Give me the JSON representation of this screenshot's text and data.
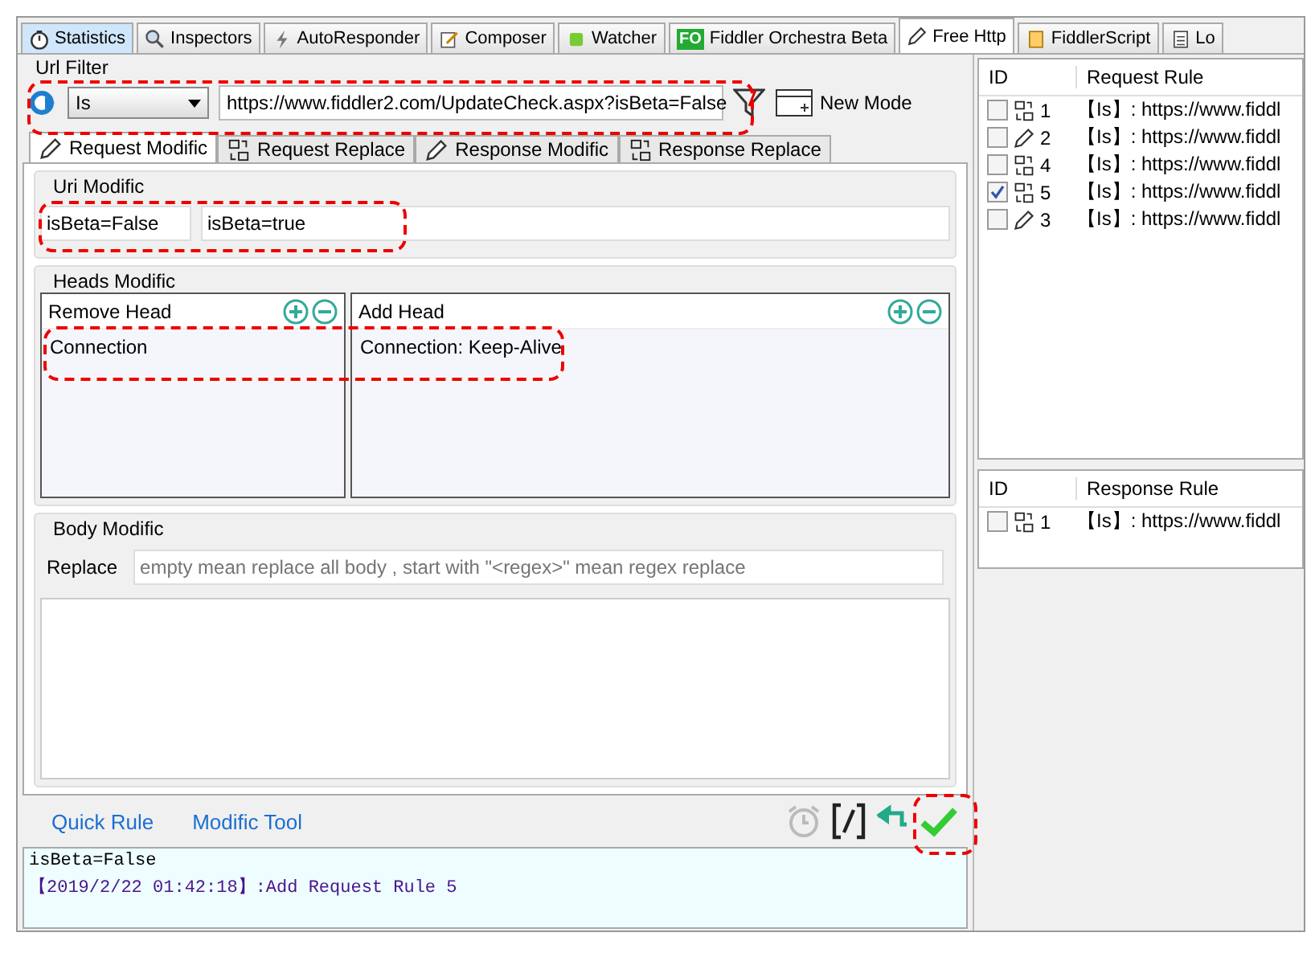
{
  "top_tabs": [
    {
      "label": "Statistics",
      "kind": "stopwatch",
      "selected": false
    },
    {
      "label": "Inspectors",
      "kind": "magnifier",
      "selected": false
    },
    {
      "label": "AutoResponder",
      "kind": "bolt",
      "selected": false
    },
    {
      "label": "Composer",
      "kind": "pencil-pad",
      "selected": false
    },
    {
      "label": "Watcher",
      "kind": "square",
      "selected": false
    },
    {
      "label": "Fiddler Orchestra Beta",
      "kind": "badge",
      "badge": "FO",
      "selected": false
    },
    {
      "label": "Free Http",
      "kind": "pencil",
      "selected": true
    },
    {
      "label": "FiddlerScript",
      "kind": "script",
      "selected": false
    },
    {
      "label": "Lo",
      "kind": "document",
      "selected": false
    }
  ],
  "url_filter": {
    "title": "Url Filter",
    "match": "Is",
    "url": "https://www.fiddler2.com/UpdateCheck.aspx?isBeta=False",
    "new_mode": "New Mode"
  },
  "sub_tabs": [
    {
      "label": "Request Modific",
      "kind": "pencil",
      "selected": true
    },
    {
      "label": "Request Replace",
      "kind": "replace",
      "selected": false
    },
    {
      "label": "Response Modific",
      "kind": "pencil",
      "selected": false
    },
    {
      "label": "Response Replace",
      "kind": "replace",
      "selected": false
    }
  ],
  "uri_modific": {
    "title": "Uri Modific",
    "find": "isBeta=False",
    "replace": "isBeta=true"
  },
  "heads_modific": {
    "title": "Heads Modific",
    "remove_head": {
      "title": "Remove Head",
      "items": [
        "Connection"
      ]
    },
    "add_head": {
      "title": "Add Head",
      "items": [
        "Connection: Keep-Alive"
      ]
    }
  },
  "body_modific": {
    "title": "Body Modific",
    "label": "Replace",
    "placeholder": "empty mean replace all body , start with \"<regex>\" mean regex replace"
  },
  "bottom_links": [
    "Quick Rule",
    "Modific Tool"
  ],
  "log": [
    "isBeta=False",
    "【2019/2/22 01:42:18】:Add Request Rule 5"
  ],
  "request_rules": {
    "columns": [
      "ID",
      "Request Rule"
    ],
    "rows": [
      {
        "checked": false,
        "kind": "replace",
        "id": "1",
        "rule": "【Is】: https://www.fiddl"
      },
      {
        "checked": false,
        "kind": "pencil",
        "id": "2",
        "rule": "【Is】: https://www.fiddl"
      },
      {
        "checked": false,
        "kind": "replace",
        "id": "4",
        "rule": "【Is】: https://www.fiddl"
      },
      {
        "checked": true,
        "kind": "replace",
        "id": "5",
        "rule": "【Is】: https://www.fiddl"
      },
      {
        "checked": false,
        "kind": "pencil",
        "id": "3",
        "rule": "【Is】: https://www.fiddl"
      }
    ]
  },
  "response_rules": {
    "columns": [
      "ID",
      "Response Rule"
    ],
    "rows": [
      {
        "checked": false,
        "kind": "replace",
        "id": "1",
        "rule": "【Is】: https://www.fiddl"
      }
    ]
  }
}
